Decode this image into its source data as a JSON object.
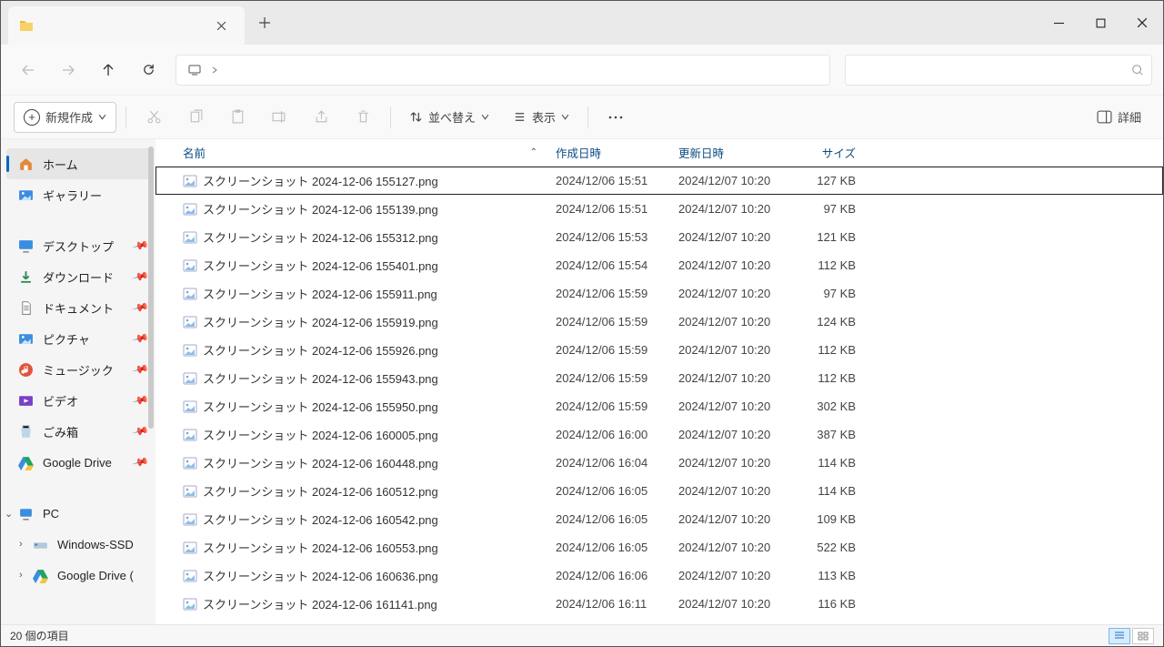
{
  "tab_title": "",
  "toolbar": {
    "new_label": "新規作成",
    "sort_label": "並べ替え",
    "view_label": "表示",
    "details_label": "詳細"
  },
  "sidebar": {
    "home": "ホーム",
    "gallery": "ギャラリー",
    "desktop": "デスクトップ",
    "downloads": "ダウンロード",
    "documents": "ドキュメント",
    "pictures": "ピクチャ",
    "music": "ミュージック",
    "videos": "ビデオ",
    "recycle": "ごみ箱",
    "gdrive": "Google Drive",
    "pc": "PC",
    "windows_ssd": "Windows-SSD",
    "gdrive2": "Google Drive ("
  },
  "columns": {
    "name": "名前",
    "created": "作成日時",
    "modified": "更新日時",
    "size": "サイズ"
  },
  "files": [
    {
      "name": "スクリーンショット 2024-12-06 155127.png",
      "created": "2024/12/06 15:51",
      "modified": "2024/12/07 10:20",
      "size": "127 KB"
    },
    {
      "name": "スクリーンショット 2024-12-06 155139.png",
      "created": "2024/12/06 15:51",
      "modified": "2024/12/07 10:20",
      "size": "97 KB"
    },
    {
      "name": "スクリーンショット 2024-12-06 155312.png",
      "created": "2024/12/06 15:53",
      "modified": "2024/12/07 10:20",
      "size": "121 KB"
    },
    {
      "name": "スクリーンショット 2024-12-06 155401.png",
      "created": "2024/12/06 15:54",
      "modified": "2024/12/07 10:20",
      "size": "112 KB"
    },
    {
      "name": "スクリーンショット 2024-12-06 155911.png",
      "created": "2024/12/06 15:59",
      "modified": "2024/12/07 10:20",
      "size": "97 KB"
    },
    {
      "name": "スクリーンショット 2024-12-06 155919.png",
      "created": "2024/12/06 15:59",
      "modified": "2024/12/07 10:20",
      "size": "124 KB"
    },
    {
      "name": "スクリーンショット 2024-12-06 155926.png",
      "created": "2024/12/06 15:59",
      "modified": "2024/12/07 10:20",
      "size": "112 KB"
    },
    {
      "name": "スクリーンショット 2024-12-06 155943.png",
      "created": "2024/12/06 15:59",
      "modified": "2024/12/07 10:20",
      "size": "112 KB"
    },
    {
      "name": "スクリーンショット 2024-12-06 155950.png",
      "created": "2024/12/06 15:59",
      "modified": "2024/12/07 10:20",
      "size": "302 KB"
    },
    {
      "name": "スクリーンショット 2024-12-06 160005.png",
      "created": "2024/12/06 16:00",
      "modified": "2024/12/07 10:20",
      "size": "387 KB"
    },
    {
      "name": "スクリーンショット 2024-12-06 160448.png",
      "created": "2024/12/06 16:04",
      "modified": "2024/12/07 10:20",
      "size": "114 KB"
    },
    {
      "name": "スクリーンショット 2024-12-06 160512.png",
      "created": "2024/12/06 16:05",
      "modified": "2024/12/07 10:20",
      "size": "114 KB"
    },
    {
      "name": "スクリーンショット 2024-12-06 160542.png",
      "created": "2024/12/06 16:05",
      "modified": "2024/12/07 10:20",
      "size": "109 KB"
    },
    {
      "name": "スクリーンショット 2024-12-06 160553.png",
      "created": "2024/12/06 16:05",
      "modified": "2024/12/07 10:20",
      "size": "522 KB"
    },
    {
      "name": "スクリーンショット 2024-12-06 160636.png",
      "created": "2024/12/06 16:06",
      "modified": "2024/12/07 10:20",
      "size": "113 KB"
    },
    {
      "name": "スクリーンショット 2024-12-06 161141.png",
      "created": "2024/12/06 16:11",
      "modified": "2024/12/07 10:20",
      "size": "116 KB"
    }
  ],
  "status": {
    "count_label": "20 個の項目"
  }
}
